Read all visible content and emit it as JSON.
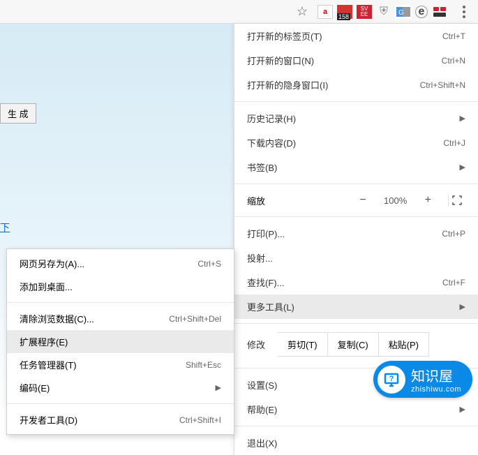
{
  "toolbar": {
    "badge": "158",
    "svee": "SV\nEE"
  },
  "page": {
    "generate_btn": "生 成",
    "link": "下"
  },
  "main_menu": {
    "new_tab": {
      "label": "打开新的标签页(T)",
      "shortcut": "Ctrl+T"
    },
    "new_window": {
      "label": "打开新的窗口(N)",
      "shortcut": "Ctrl+N"
    },
    "incognito": {
      "label": "打开新的隐身窗口(I)",
      "shortcut": "Ctrl+Shift+N"
    },
    "history": {
      "label": "历史记录(H)"
    },
    "downloads": {
      "label": "下载内容(D)",
      "shortcut": "Ctrl+J"
    },
    "bookmarks": {
      "label": "书签(B)"
    },
    "zoom": {
      "label": "缩放",
      "minus": "−",
      "pct": "100%",
      "plus": "+"
    },
    "print": {
      "label": "打印(P)...",
      "shortcut": "Ctrl+P"
    },
    "cast": {
      "label": "投射..."
    },
    "find": {
      "label": "查找(F)...",
      "shortcut": "Ctrl+F"
    },
    "more_tools": {
      "label": "更多工具(L)"
    },
    "edit": {
      "label": "修改",
      "cut": "剪切(T)",
      "copy": "复制(C)",
      "paste": "粘贴(P)"
    },
    "settings": {
      "label": "设置(S)"
    },
    "help": {
      "label": "帮助(E)"
    },
    "exit": {
      "label": "退出(X)"
    }
  },
  "sub_menu": {
    "save_as": {
      "label": "网页另存为(A)...",
      "shortcut": "Ctrl+S"
    },
    "add_desktop": {
      "label": "添加到桌面..."
    },
    "clear_data": {
      "label": "清除浏览数据(C)...",
      "shortcut": "Ctrl+Shift+Del"
    },
    "extensions": {
      "label": "扩展程序(E)"
    },
    "task_mgr": {
      "label": "任务管理器(T)",
      "shortcut": "Shift+Esc"
    },
    "encoding": {
      "label": "编码(E)"
    },
    "dev_tools": {
      "label": "开发者工具(D)",
      "shortcut": "Ctrl+Shift+I"
    }
  },
  "watermark": {
    "icon": "?",
    "title": "知识屋",
    "sub": "zhishiwu.com"
  }
}
